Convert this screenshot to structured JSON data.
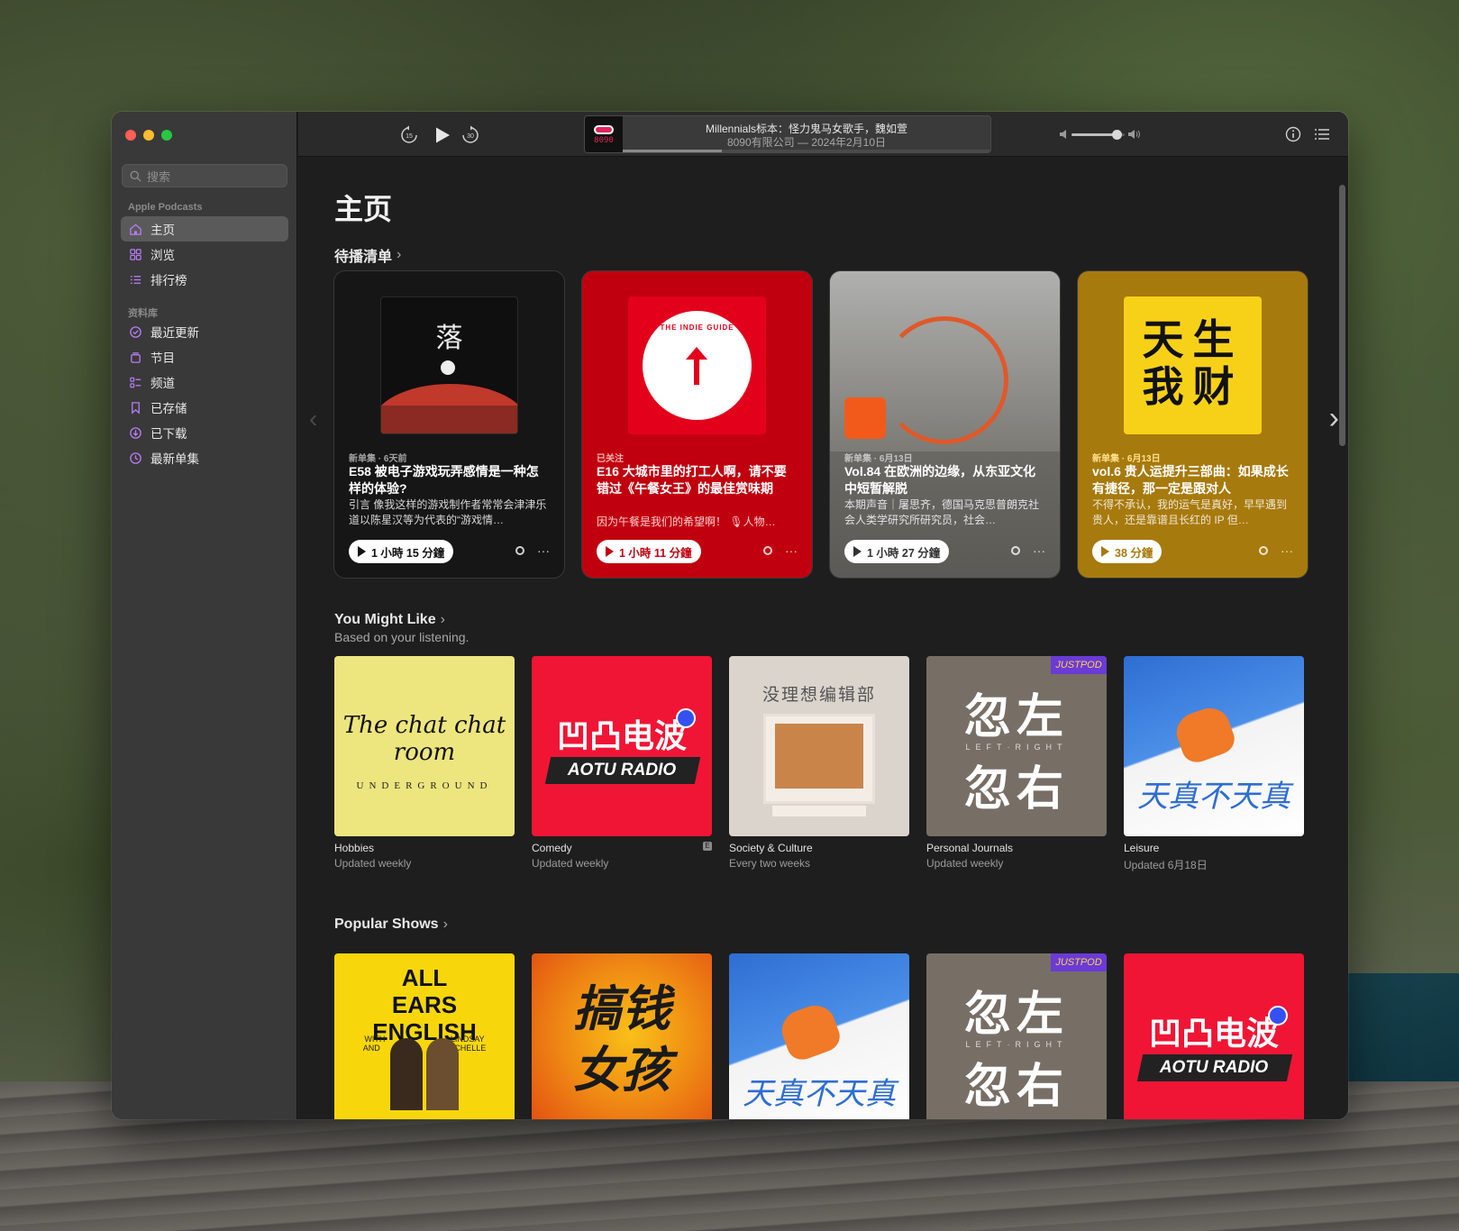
{
  "window": {
    "title": "Apple Podcasts"
  },
  "sidebar": {
    "search_placeholder": "搜索",
    "section_apple": "Apple Podcasts",
    "apple_items": [
      {
        "label": "主页",
        "icon": "home-icon"
      },
      {
        "label": "浏览",
        "icon": "grid-icon"
      },
      {
        "label": "排行榜",
        "icon": "list-icon"
      }
    ],
    "section_library": "资料库",
    "library_items": [
      {
        "label": "最近更新",
        "icon": "clock-check-icon"
      },
      {
        "label": "节目",
        "icon": "podcast-stack-icon"
      },
      {
        "label": "频道",
        "icon": "channels-icon"
      },
      {
        "label": "已存储",
        "icon": "bookmark-icon"
      },
      {
        "label": "已下载",
        "icon": "download-icon"
      },
      {
        "label": "最新单集",
        "icon": "clock-icon"
      }
    ]
  },
  "toolbar": {
    "skip_back": "15",
    "skip_forward": "30",
    "now_playing": {
      "title": "Millennials标本：怪力鬼马女歌手，魏如萱",
      "subtitle": "8090有限公司 — 2024年2月10日",
      "art_text": "8090",
      "progress": 0.27
    },
    "volume": 0.85
  },
  "main": {
    "page_title": "主页",
    "up_next": {
      "title": "待播清单",
      "cards": [
        {
          "meta": "新单集 · 6天前",
          "title": "E58 被电子游戏玩弄感情是一种怎样的体验?",
          "description": "引言  像我这样的游戏制作者常常会津津乐道以陈星汉等为代表的“游戏情…",
          "duration": "1 小時 15 分鐘",
          "art_text": "落",
          "bg": "#161616",
          "accent": "#000000"
        },
        {
          "meta": "已关注",
          "title": "E16 大城市里的打工人啊，请不要错过《午餐女王》的最佳赏味期",
          "description": "因为午餐是我们的希望啊！ 🎙人物…",
          "duration": "1 小時 11 分鐘",
          "art_text": "THE INDIE GUIDE",
          "bg": "#c1000f",
          "accent": "#c1000f"
        },
        {
          "meta": "新单集 · 6月13日",
          "title": "Vol.84 在欧洲的边缘，从东亚文化中短暂解脱",
          "description": "本期声音｜屠思齐，德国马克思普朗克社会人类学研究所研究员，社会…",
          "duration": "1 小時 27 分鐘",
          "art_text": "",
          "bg": "#5b5a55",
          "accent": "#3a3a3a"
        },
        {
          "meta": "新单集 · 6月13日",
          "title": "vol.6 贵人运提升三部曲：如果成长有捷径，那一定是跟对人",
          "description": "不得不承认，我的运气是真好，早早遇到贵人，还是靠谱且长红的 IP 但…",
          "duration": "38 分鐘",
          "art_text": "天生我财",
          "bg": "#a77a0d",
          "accent": "#8a6508"
        }
      ]
    },
    "you_might_like": {
      "title": "You Might Like",
      "subtitle": "Based on your listening.",
      "shows": [
        {
          "category": "Hobbies",
          "frequency": "Updated weekly",
          "cover": "The chat chat room",
          "cover_sub": "UNDERGROUND",
          "explicit": false
        },
        {
          "category": "Comedy",
          "frequency": "Updated weekly",
          "cover": "凹凸电波",
          "cover_sub": "AOTU RADIO",
          "explicit": true
        },
        {
          "category": "Society & Culture",
          "frequency": "Every two weeks",
          "cover": "没理想编辑部",
          "cover_sub": "",
          "explicit": false
        },
        {
          "category": "Personal Journals",
          "frequency": "Updated weekly",
          "cover": "忽左忽右",
          "cover_sub": "LEFT·RIGHT",
          "explicit": false
        },
        {
          "category": "Leisure",
          "frequency": "Updated 6月18日",
          "cover": "天真不天真",
          "cover_sub": "",
          "explicit": false
        }
      ]
    },
    "popular_shows": {
      "title": "Popular Shows",
      "shows": [
        {
          "cover": "ALL EARS ENGLISH",
          "cover_sub": "WITH LINDSAY AND MICHELLE"
        },
        {
          "cover": "搞钱女孩",
          "cover_sub": ""
        },
        {
          "cover": "天真不天真",
          "cover_sub": ""
        },
        {
          "cover": "忽左忽右",
          "cover_sub": "LEFT·RIGHT"
        },
        {
          "cover": "凹凸电波",
          "cover_sub": "AOTU RADIO"
        }
      ]
    }
  },
  "colors": {
    "accent": "#b87df5",
    "sidebar_bg": "#393939",
    "main_bg": "#1e1e1e"
  }
}
